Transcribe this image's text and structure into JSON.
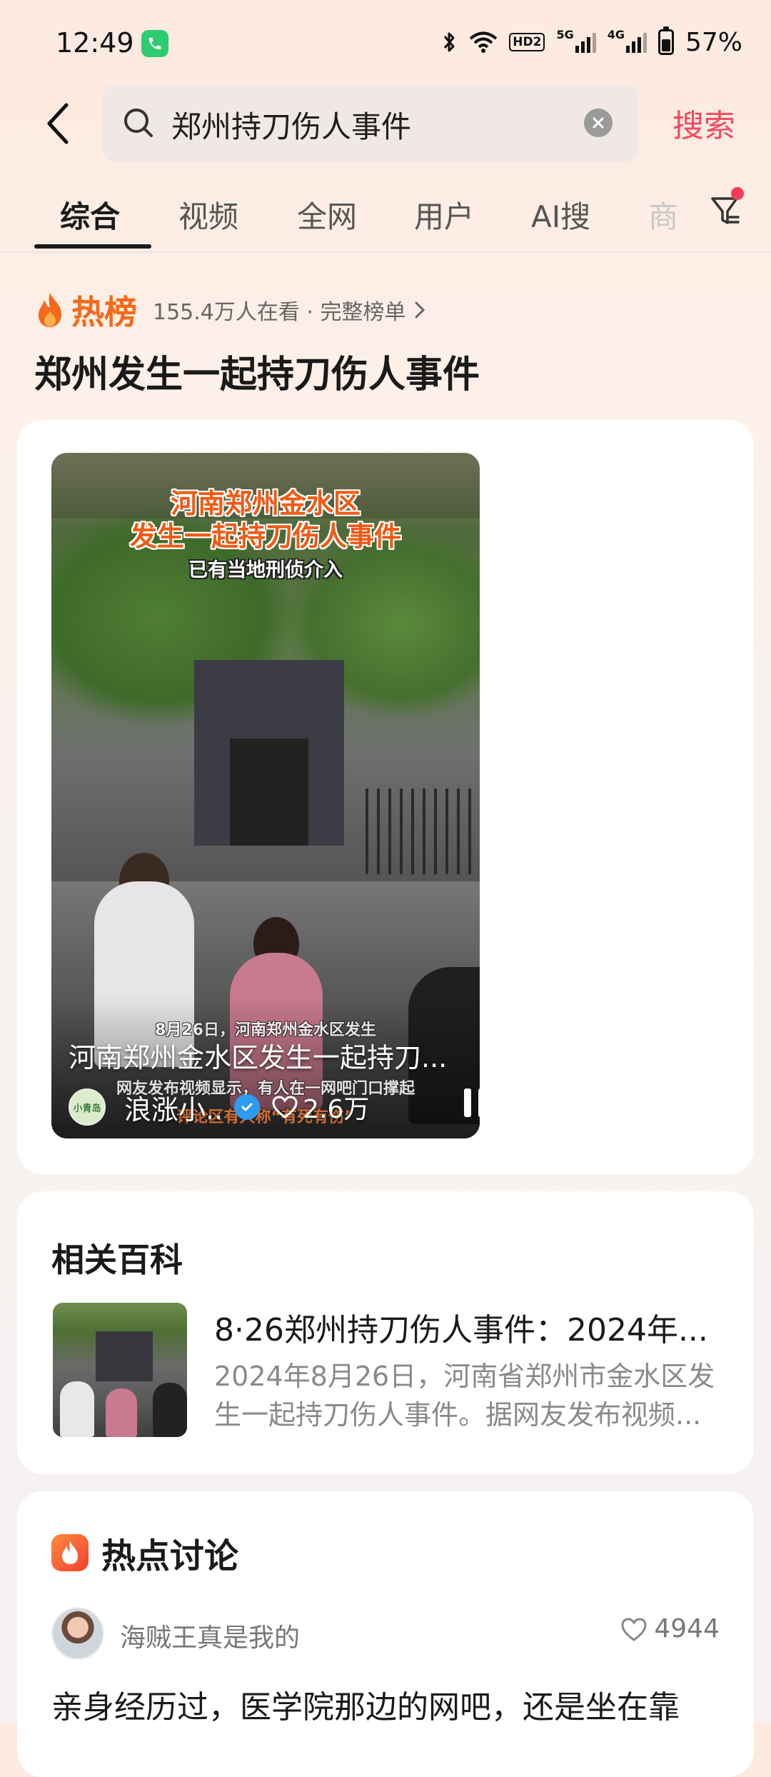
{
  "status_bar": {
    "time": "12:49",
    "network_5g": "5G",
    "network_4g": "4G",
    "hd_label": "HD2",
    "battery_percent": "57%",
    "battery_level": 0.57
  },
  "header": {
    "search_query": "郑州持刀伤人事件",
    "search_button": "搜索"
  },
  "tabs": [
    {
      "label": "综合",
      "active": true
    },
    {
      "label": "视频"
    },
    {
      "label": "全网"
    },
    {
      "label": "用户"
    },
    {
      "label": "AI搜"
    },
    {
      "label": "商"
    }
  ],
  "hot": {
    "label": "热榜",
    "meta": "155.4万人在看 · 完整榜单",
    "topic_title": "郑州发生一起持刀伤人事件"
  },
  "video": {
    "overlay_title_line1": "河南郑州金水区",
    "overlay_title_line2": "发生一起持刀伤人事件",
    "overlay_subtitle": "已有当地刑侦介入",
    "overlay_caption_top": "8月26日，河南郑州金水区发生",
    "overlay_caption_mid": "网友发布视频显示，有人在一网吧门口撑起",
    "overlay_caption_bottom": "评论区有人称“有死有伤”",
    "caption": "河南郑州金水区发生一起持刀...",
    "author": "浪涨小..",
    "avatar_text": "小青岛",
    "likes": "2.6万"
  },
  "wiki": {
    "heading": "相关百科",
    "title": "8·26郑州持刀伤人事件：2024年...",
    "description": "2024年8月26日，河南省郑州市金水区发生一起持刀伤人事件。据网友发布视频..."
  },
  "discussion": {
    "heading": "热点讨论",
    "username": "海贼王真是我的",
    "likes": "4944",
    "text": "亲身经历过，医学院那边的网吧，还是坐在靠"
  },
  "colors": {
    "accent": "#f04a5e",
    "hot_orange": "#f26a1b"
  }
}
